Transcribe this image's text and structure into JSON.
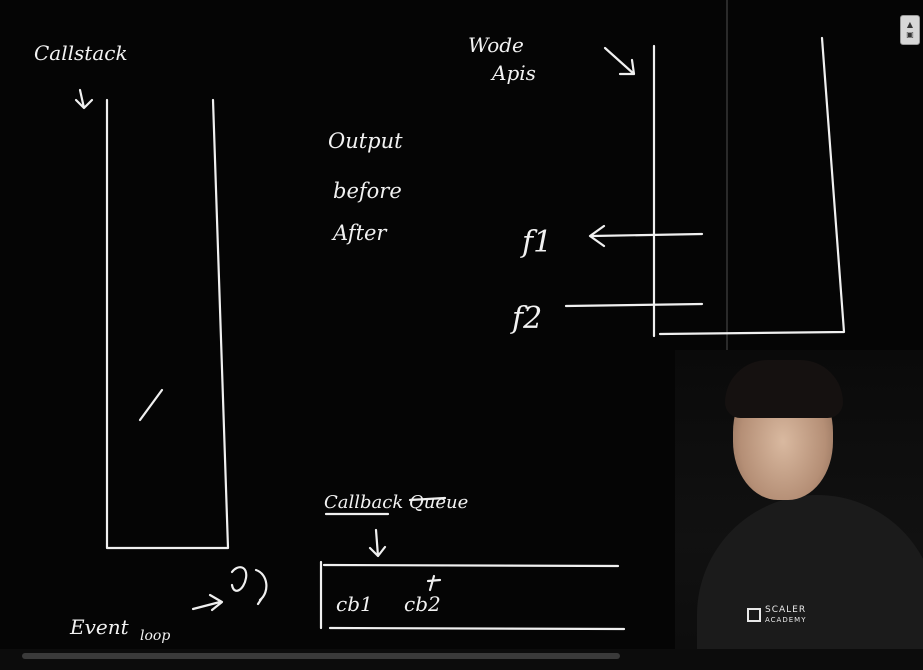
{
  "board": {
    "call_stack_label": "Callstack",
    "web_apis_label_1": "Wode",
    "web_apis_label_2": "Apis",
    "output_label": "Output",
    "output_line_1": "before",
    "output_line_2": "After",
    "f1_label": "f1",
    "f2_label": "f2",
    "callback_queue_label": "Callback Queue",
    "queue_item_1": "cb2",
    "queue_item_2": "cb1",
    "event_loop_label_1": "Event",
    "event_loop_label_2": "loop"
  },
  "webcam": {
    "shirt_logo_text": "SCALER",
    "shirt_logo_sub": "ACADEMY"
  },
  "corner_widget": {
    "glyph_top": "▲",
    "glyph_bottom": "▣"
  }
}
